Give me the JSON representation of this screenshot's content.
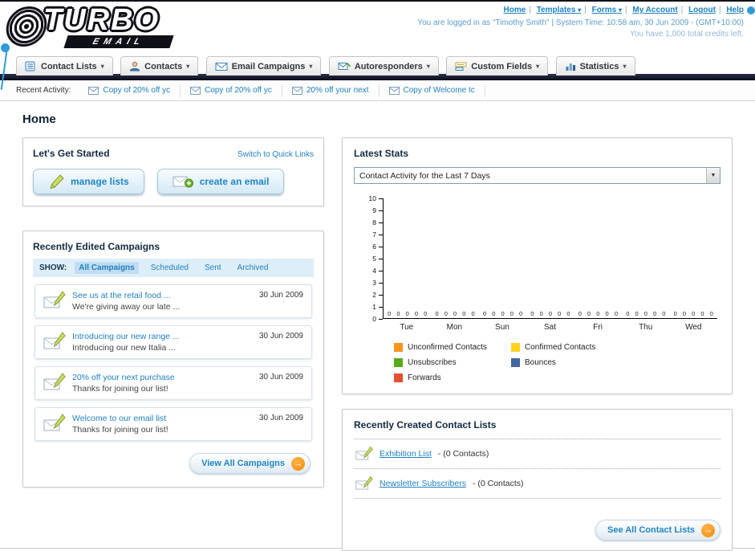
{
  "logo": {
    "line1": "TURBO",
    "line2": "EMAIL"
  },
  "header": {
    "links": [
      "Home",
      "Templates",
      "Forms",
      "My Account",
      "Logout",
      "Help"
    ],
    "session": "You are logged in as \"Timothy Smith\" | System Time: 10:58 am, 30 Jun 2009 - (GMT+10:00)",
    "credits": "You have 1,000 total credits left."
  },
  "nav_tabs": [
    {
      "label": "Contact Lists"
    },
    {
      "label": "Contacts"
    },
    {
      "label": "Email Campaigns"
    },
    {
      "label": "Autoresponders"
    },
    {
      "label": "Custom Fields"
    },
    {
      "label": "Statistics"
    }
  ],
  "activity": {
    "label": "Recent Activity:",
    "items": [
      "Copy of 20% off yc",
      "Copy of 20% off yc",
      "20% off your next",
      "Copy of Welcome tc"
    ]
  },
  "page_title": "Home",
  "get_started": {
    "title": "Let's Get Started",
    "switch_link": "Switch to Quick Links",
    "manage_button": "manage lists",
    "create_button": "create an email"
  },
  "campaigns": {
    "title": "Recently Edited Campaigns",
    "show_label": "SHOW:",
    "tabs": [
      "All Campaigns",
      "Scheduled",
      "Sent",
      "Archived"
    ],
    "active_tab": "All Campaigns",
    "items": [
      {
        "title": "See us at the retail food ...",
        "subtitle": "We're giving away our late ...",
        "date": "30 Jun 2009"
      },
      {
        "title": "Introducing our new range ...",
        "subtitle": "Introducing our new Italia ...",
        "date": "30 Jun 2009"
      },
      {
        "title": "20% off your next purchase",
        "subtitle": "Thanks for joining our list!",
        "date": "30 Jun 2009"
      },
      {
        "title": "Welcome to our email list",
        "subtitle": "Thanks for joining our list!",
        "date": "30 Jun 2009"
      }
    ],
    "view_all_label": "View All Campaigns"
  },
  "stats": {
    "title": "Latest Stats",
    "selector": "Contact Activity for the Last 7 Days"
  },
  "chart_data": {
    "type": "bar",
    "title": "Contact Activity for the Last 7 Days",
    "categories": [
      "Tue",
      "Mon",
      "Sun",
      "Sat",
      "Fri",
      "Thu",
      "Wed"
    ],
    "series": [
      {
        "name": "Unconfirmed Contacts",
        "color": "#f7941d",
        "values": [
          0,
          0,
          0,
          0,
          0,
          0,
          0
        ]
      },
      {
        "name": "Confirmed Contacts",
        "color": "#ffd21e",
        "values": [
          0,
          0,
          0,
          0,
          0,
          0,
          0
        ]
      },
      {
        "name": "Unsubscribes",
        "color": "#5aa91c",
        "values": [
          0,
          0,
          0,
          0,
          0,
          0,
          0
        ]
      },
      {
        "name": "Bounces",
        "color": "#44679f",
        "values": [
          0,
          0,
          0,
          0,
          0,
          0,
          0
        ]
      },
      {
        "name": "Forwards",
        "color": "#e2512e",
        "values": [
          0,
          0,
          0,
          0,
          0,
          0,
          0
        ]
      }
    ],
    "ylim": [
      0,
      10
    ],
    "ytick_step": 1,
    "grid": false,
    "legend_position": "bottom"
  },
  "contact_lists": {
    "title": "Recently Created Contact Lists",
    "items": [
      {
        "name": "Exhibition List",
        "suffix": "- (0 Contacts)"
      },
      {
        "name": "Newsletter Subscribers",
        "suffix": "- (0 Contacts)"
      }
    ],
    "see_all_label": "See All Contact Lists"
  },
  "colors": {
    "accent_blue": "#2e9ad8",
    "link_blue": "#1f80c2",
    "navy": "#122a40",
    "orange": "#f7941d"
  }
}
